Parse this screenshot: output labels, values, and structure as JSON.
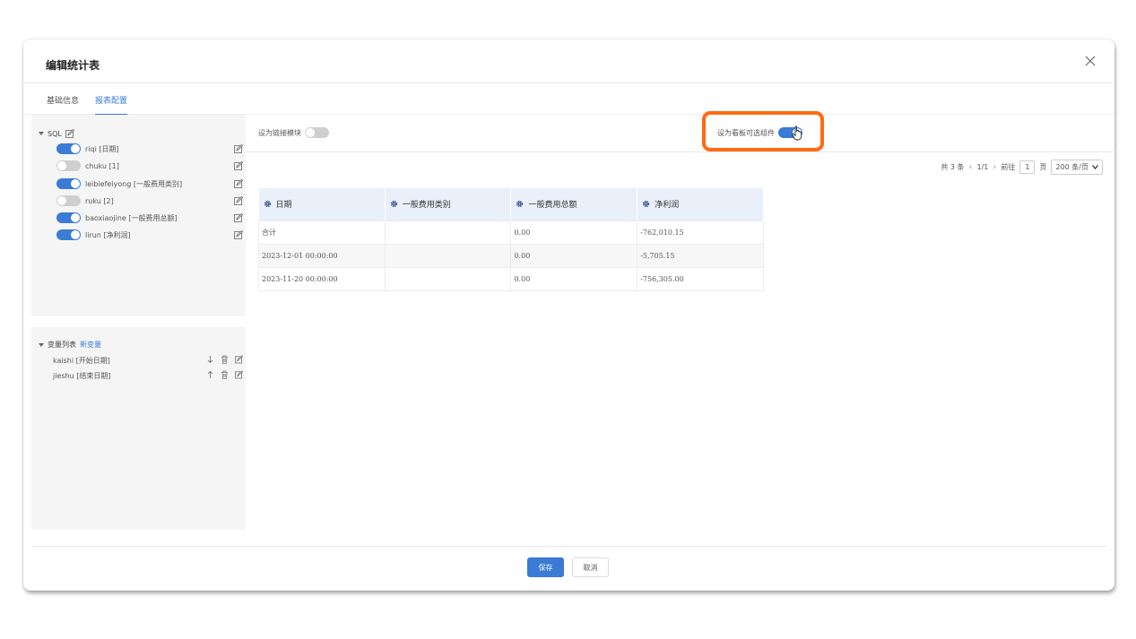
{
  "dialog": {
    "title": "编辑统计表",
    "tabs": [
      "基础信息",
      "报表配置"
    ]
  },
  "sql_tree": {
    "header": "SQL",
    "fields": [
      {
        "label": "riqi [日期]",
        "enabled": true
      },
      {
        "label": "chuku [1]",
        "enabled": false
      },
      {
        "label": "leibiefeiyong [一般费用类别]",
        "enabled": true
      },
      {
        "label": "ruku [2]",
        "enabled": false
      },
      {
        "label": "baoxiaojine [一般费用总额]",
        "enabled": true
      },
      {
        "label": "lirun [净利润]",
        "enabled": true
      }
    ]
  },
  "variables": {
    "header": "变量列表",
    "add_link": "新变量",
    "items": [
      {
        "label": "kaishi [开始日期]",
        "move": "down"
      },
      {
        "label": "jieshu [结束日期]",
        "move": "up"
      }
    ]
  },
  "options": {
    "link_module": {
      "label": "设为链接模块",
      "enabled": false
    },
    "dashboard_component": {
      "label": "设为看板可选组件",
      "enabled": true
    }
  },
  "pagination": {
    "total": "共 3 条",
    "pages": "1/1",
    "goto": "前往",
    "page_input": "1",
    "page_unit": "页",
    "page_size": "200 条/页"
  },
  "table": {
    "columns": [
      "日期",
      "一般费用类别",
      "一般费用总额",
      "净利润"
    ],
    "rows": [
      [
        "合计",
        "",
        "0.00",
        "-762,010.15"
      ],
      [
        "2023-12-01 00:00:00",
        "",
        "0.00",
        "-5,705.15"
      ],
      [
        "2023-11-20 00:00:00",
        "",
        "0.00",
        "-756,305.00"
      ]
    ]
  },
  "footer": {
    "save": "保存",
    "cancel": "取消"
  },
  "colors": {
    "accent": "#3a7bd5",
    "highlight": "#ff6a13"
  }
}
